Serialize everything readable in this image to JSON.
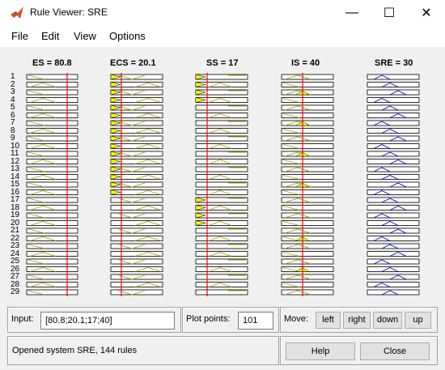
{
  "window": {
    "title": "Rule Viewer: SRE",
    "minimize_glyph": "—",
    "maximize_glyph": "☐",
    "close_glyph": "✕",
    "icon": "matlab-icon"
  },
  "menu": [
    "File",
    "Edit",
    "View",
    "Options"
  ],
  "variables": [
    {
      "label": "ES = 80.8",
      "kind": "input"
    },
    {
      "label": "ECS = 20.1",
      "kind": "input"
    },
    {
      "label": "SS = 17",
      "kind": "input"
    },
    {
      "label": "IS = 40",
      "kind": "input"
    },
    {
      "label": "SRE = 30",
      "kind": "output"
    }
  ],
  "rules": [
    "1",
    "2",
    "3",
    "4",
    "5",
    "6",
    "7",
    "8",
    "9",
    "10",
    "11",
    "12",
    "13",
    "14",
    "15",
    "16",
    "17",
    "18",
    "19",
    "20",
    "21",
    "22",
    "23",
    "24",
    "25",
    "26",
    "27",
    "28",
    "29"
  ],
  "colors": {
    "input_fill": "#ffff00",
    "input_line": "#a0a000",
    "output_line": "#0000c8",
    "marker_line": "#ff0000",
    "background": "#f0f0f0"
  },
  "input": {
    "label": "Input:",
    "value": "[80.8;20.1;17;40]"
  },
  "plot_points": {
    "label": "Plot points:",
    "value": "101"
  },
  "move": {
    "label": "Move:",
    "buttons": [
      "left",
      "right",
      "down",
      "up"
    ]
  },
  "status": "Opened system SRE, 144 rules",
  "help_label": "Help",
  "close_label": "Close"
}
